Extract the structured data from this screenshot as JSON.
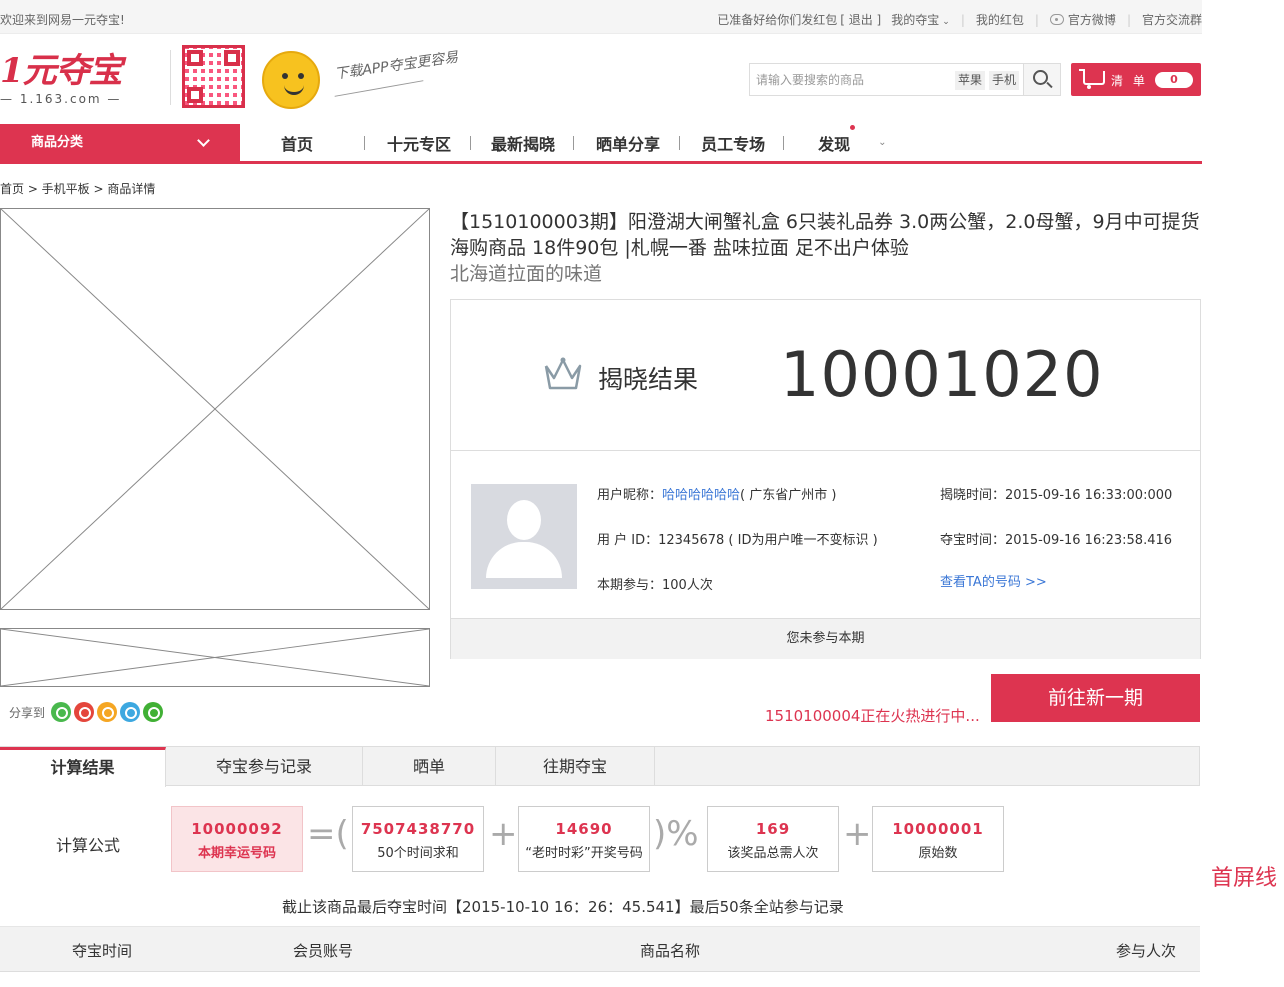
{
  "topbar": {
    "welcome": "欢迎来到网易一元夺宝!",
    "greeting": "已准备好给你们发红包",
    "logout": "[ 退出 ]",
    "my_duobao": "我的夺宝",
    "my_redpacket": "我的红包",
    "official_weibo": "官方微博",
    "official_group": "官方交流群"
  },
  "header": {
    "logo_text": "1元夺宝",
    "logo_domain": "— 1.163.com —",
    "slogan": "下载APP夺宝更容易",
    "search": {
      "placeholder": "请输入要搜索的商品",
      "hotwords": [
        "苹果",
        "手机"
      ]
    },
    "cart": {
      "label": "清 单",
      "count": "0"
    }
  },
  "nav": {
    "category_label": "商品分类",
    "links": [
      "首页",
      "十元专区",
      "最新揭晓",
      "晒单分享",
      "员工专场",
      "发现"
    ]
  },
  "breadcrumb": "首页 > 手机平板 > 商品详情",
  "share": {
    "label": "分享到"
  },
  "product": {
    "title": "【1510100003期】阳澄湖大闸蟹礼盒 6只装礼品券 3.0两公蟹，2.0母蟹，9月中可提货  海购商品 18件90包 |札幌一番 盐味拉面 足不出户体验",
    "subtitle": "北海道拉面的味道"
  },
  "result": {
    "label": "揭晓结果",
    "number": "10001020",
    "nickname_label": "用户昵称：",
    "nickname": "哈哈哈哈哈哈",
    "location": "( 广东省广州市 )",
    "uid_line": "用  户 ID：12345678 ( ID为用户唯一不变标识 )",
    "participation": "本期参与：100人次",
    "reveal_time": "揭晓时间：2015-09-16  16:33:00:000",
    "duobao_time": "夺宝时间：2015-09-16  16:23:58.416",
    "view_codes": "查看TA的号码 >>",
    "not_joined": "您未参与本期"
  },
  "ongoing": "1510100004正在火热进行中...",
  "new_period_button": "前往新一期",
  "tabs": [
    "计算结果",
    "夺宝参与记录",
    "晒单",
    "往期夺宝"
  ],
  "formula": {
    "label": "计算公式",
    "lucky": {
      "value": "10000092",
      "desc": "本期幸运号码"
    },
    "time_sum": {
      "value": "7507438770",
      "desc": "50个时间求和"
    },
    "lottery": {
      "value": "14690",
      "desc": "“老时时彩”开奖号码"
    },
    "total": {
      "value": "169",
      "desc": "该奖品总需人次"
    },
    "base": {
      "value": "10000001",
      "desc": "原始数"
    },
    "ops": {
      "eq": "=(",
      "plus": "+",
      "mod": ")%"
    }
  },
  "deadline_note": "截止该商品最后夺宝时间【2015-10-10  16：26：45.541】最后50条全站参与记录",
  "fold_line": "首屏线",
  "table": {
    "headers": [
      "夺宝时间",
      "会员账号",
      "商品名称",
      "参与人次"
    ]
  },
  "colors": {
    "accent": "#dd3450",
    "link": "#3b77d6"
  }
}
